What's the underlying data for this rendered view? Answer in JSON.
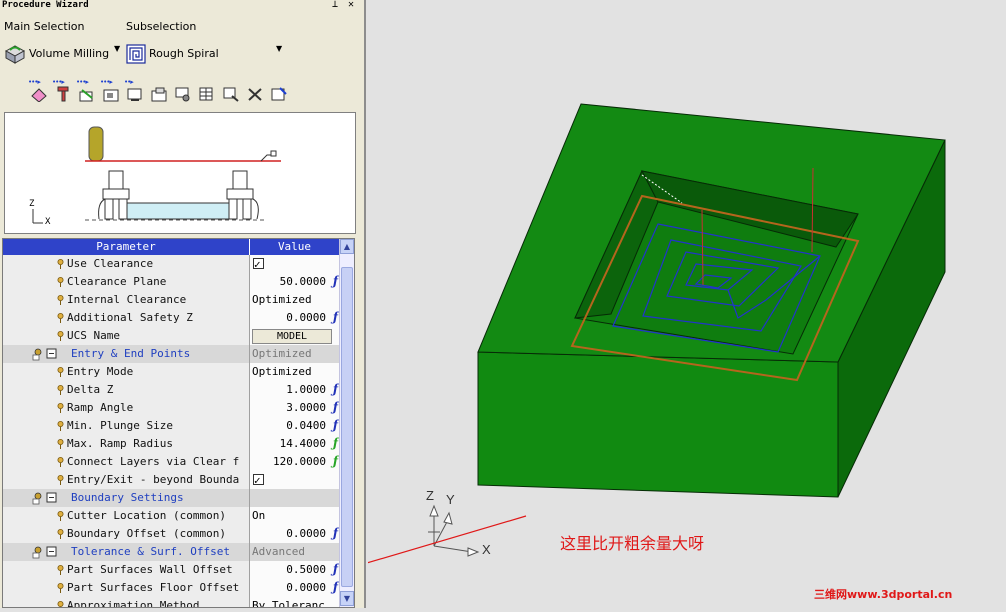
{
  "window": {
    "title": "Procedure Wizard"
  },
  "selection": {
    "main_label": "Main Selection",
    "main_value": "Volume Milling",
    "sub_label": "Subselection",
    "sub_value": "Rough Spiral"
  },
  "toolbar": {
    "icons": [
      "eraser-icon",
      "tool-icon",
      "part-icon",
      "stock-icon",
      "machine-icon",
      "export-icon",
      "settings-icon",
      "table-icon",
      "process-icon",
      "check-icon",
      "output-icon"
    ]
  },
  "preview": {
    "axis_z": "Z",
    "axis_x": "X"
  },
  "grid": {
    "header_param": "Parameter",
    "header_value": "Value",
    "rows": [
      {
        "param": "Use Clearance",
        "value": ""
      },
      {
        "param": "Clearance Plane",
        "value": "50.0000"
      },
      {
        "param": "Internal Clearance",
        "value": "Optimized"
      },
      {
        "param": "Additional Safety Z",
        "value": "0.0000"
      },
      {
        "param": "UCS Name",
        "value": "MODEL"
      },
      {
        "param": "Entry & End Points",
        "value": "Optimized"
      },
      {
        "param": "Entry Mode",
        "value": "Optimized"
      },
      {
        "param": "Delta Z",
        "value": "1.0000"
      },
      {
        "param": "Ramp Angle",
        "value": "3.0000"
      },
      {
        "param": "Min. Plunge Size",
        "value": "0.0400"
      },
      {
        "param": "Max. Ramp Radius",
        "value": "14.4000"
      },
      {
        "param": "Connect Layers via Clear f",
        "value": "120.0000"
      },
      {
        "param": "Entry/Exit - beyond Bounda",
        "value": ""
      },
      {
        "param": "Boundary Settings",
        "value": ""
      },
      {
        "param": "Cutter Location (common)",
        "value": "On"
      },
      {
        "param": "Boundary Offset (common)",
        "value": "0.0000"
      },
      {
        "param": "Tolerance & Surf. Offset",
        "value": "Advanced"
      },
      {
        "param": "Part Surfaces Wall Offset",
        "value": "0.5000"
      },
      {
        "param": "Part Surfaces Floor Offset",
        "value": "0.0000"
      },
      {
        "param": "Approximation Method",
        "value": "By Toleranc"
      }
    ]
  },
  "viewport": {
    "annotation": "这里比开粗余量大呀",
    "watermark": "三维网www.3dportal.cn",
    "axis_z": "Z",
    "axis_y": "Y",
    "axis_x": "X",
    "colors": {
      "block": "#138a13",
      "block_dark": "#0c6a0c",
      "toolpath": "#2233cc",
      "boundary": "#b5651d",
      "annotation": "#e01818"
    }
  }
}
